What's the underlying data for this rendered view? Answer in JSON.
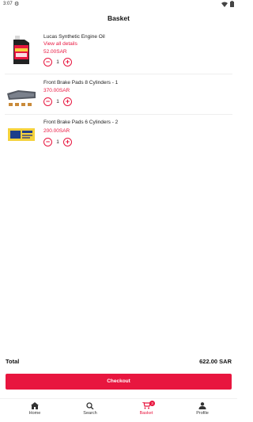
{
  "status_bar": {
    "time": "3:07",
    "settings_icon": "gear-icon",
    "wifi_icon": "wifi-icon",
    "battery_icon": "battery-icon"
  },
  "header": {
    "title": "Basket"
  },
  "items": [
    {
      "name": "Lucas Synthetic Engine Oil",
      "link": "View all details",
      "price": "52.00SAR",
      "quantity": "1"
    },
    {
      "name": "Front Brake Pads 8 Cylinders - 1",
      "price": "370.00SAR",
      "quantity": "1"
    },
    {
      "name": "Front Brake Pads 6 Cylinders - 2",
      "price": "200.00SAR",
      "quantity": "1"
    }
  ],
  "summary": {
    "total_label": "Total",
    "total_value": "622.00 SAR"
  },
  "checkout": {
    "label": "Checkout"
  },
  "bottom_nav": {
    "items": [
      {
        "label": "Home",
        "icon": "home-icon"
      },
      {
        "label": "Search",
        "icon": "search-icon"
      },
      {
        "label": "Basket",
        "icon": "cart-icon",
        "badge": "3"
      },
      {
        "label": "Profile",
        "icon": "person-icon"
      }
    ],
    "active": "Basket"
  },
  "colors": {
    "accent": "#e8163f"
  }
}
